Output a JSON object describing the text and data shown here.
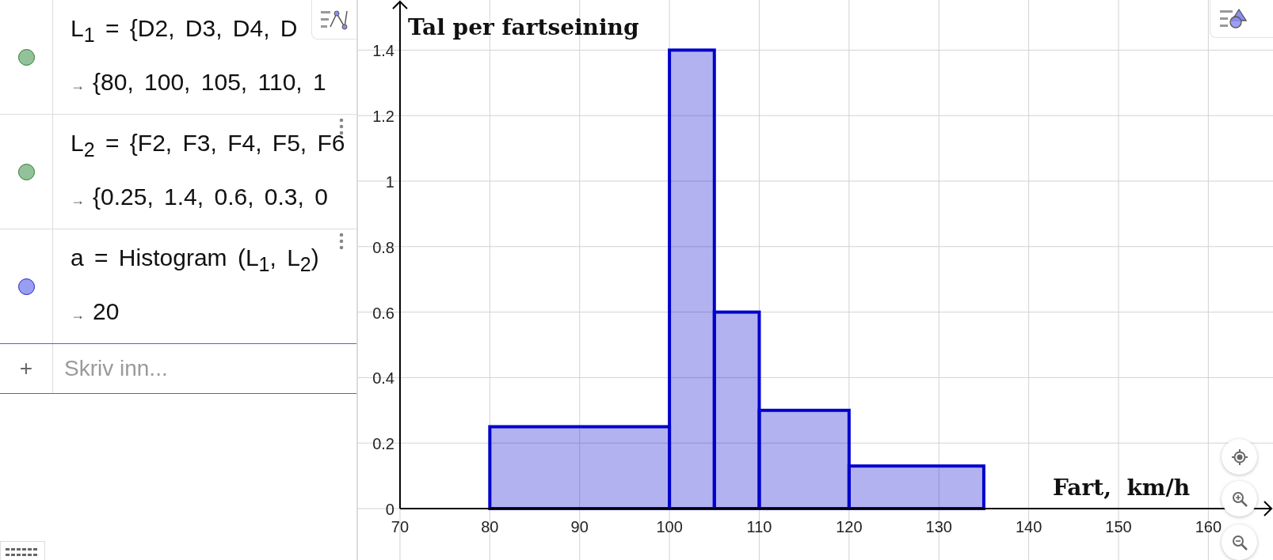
{
  "algebra": {
    "items": [
      {
        "color": "#93c29a",
        "definition": "L$_{1}$ = {D2, D3, D4, D",
        "arrow": "→",
        "value": "{80, 100, 105, 110, 1",
        "menu": false
      },
      {
        "color": "#93c29a",
        "definition": "L$_{2}$ = {F2, F3, F4, F5, F6",
        "arrow": "→",
        "value": "{0.25, 1.4, 0.6, 0.3, 0",
        "menu": true
      },
      {
        "color": "#9a9ef0",
        "definition": "a = Histogram (L$_{1}$, L$_{2}$)",
        "arrow": "→",
        "value": "20",
        "menu": true
      }
    ],
    "input": {
      "icon": "+",
      "placeholder": "Skriv inn..."
    }
  },
  "graphics": {
    "chart_data": {
      "type": "bar",
      "xlabel": "Fart,  km/h",
      "ylabel": "Tal per fartseining",
      "x": [
        90,
        102.5,
        107.5,
        115,
        127.5
      ],
      "series": [
        {
          "color": "#0000cc",
          "values": [
            0.25,
            1.4,
            0.6,
            0.3,
            0.13
          ]
        }
      ],
      "grid": true,
      "xlim": [
        65.33,
        167.2
      ],
      "ylim": [
        -0.157,
        1.553
      ],
      "xticks": [
        70,
        80,
        90,
        100,
        110,
        120,
        130,
        140,
        150,
        160
      ],
      "yticks": [
        0,
        0.2,
        0.4,
        0.6,
        0.8,
        1,
        1.2,
        1.4
      ]
    }
  }
}
